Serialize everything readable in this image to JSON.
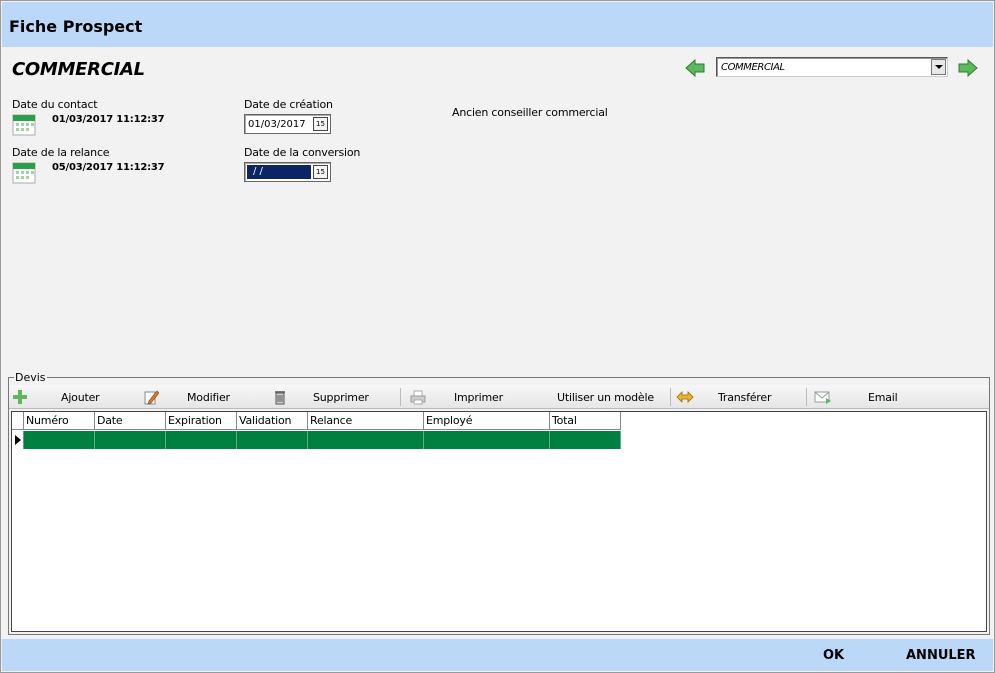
{
  "window": {
    "title": "Fiche Prospect"
  },
  "header": {
    "section_title": "COMMERCIAL",
    "selector_value": "COMMERCIAL"
  },
  "fields": {
    "contact_label": "Date du contact",
    "contact_value": "01/03/2017 11:12:37",
    "relance_label": "Date de la relance",
    "relance_value": "05/03/2017 11:12:37",
    "creation_label": "Date de création",
    "creation_value": "01/03/2017",
    "conversion_label": "Date de la conversion",
    "conversion_value": " / /",
    "former_advisor_label": "Ancien conseiller commercial",
    "date_button_glyph": "15"
  },
  "devis": {
    "legend": "Devis",
    "toolbar": {
      "add": "Ajouter",
      "edit": "Modifier",
      "delete": "Supprimer",
      "print": "Imprimer",
      "template": "Utiliser un modèle",
      "transfer": "Transférer",
      "email": "Email"
    },
    "columns": [
      "Numéro",
      "Date",
      "Expiration",
      "Validation",
      "Relance",
      "Employé",
      "Total"
    ]
  },
  "footer": {
    "ok": "OK",
    "cancel": "ANNULER"
  },
  "colors": {
    "title_bar": "#bcd8f9",
    "selected_row": "#008040",
    "conversion_field": "#0b2466",
    "nav_arrow": "#5cb85c"
  }
}
